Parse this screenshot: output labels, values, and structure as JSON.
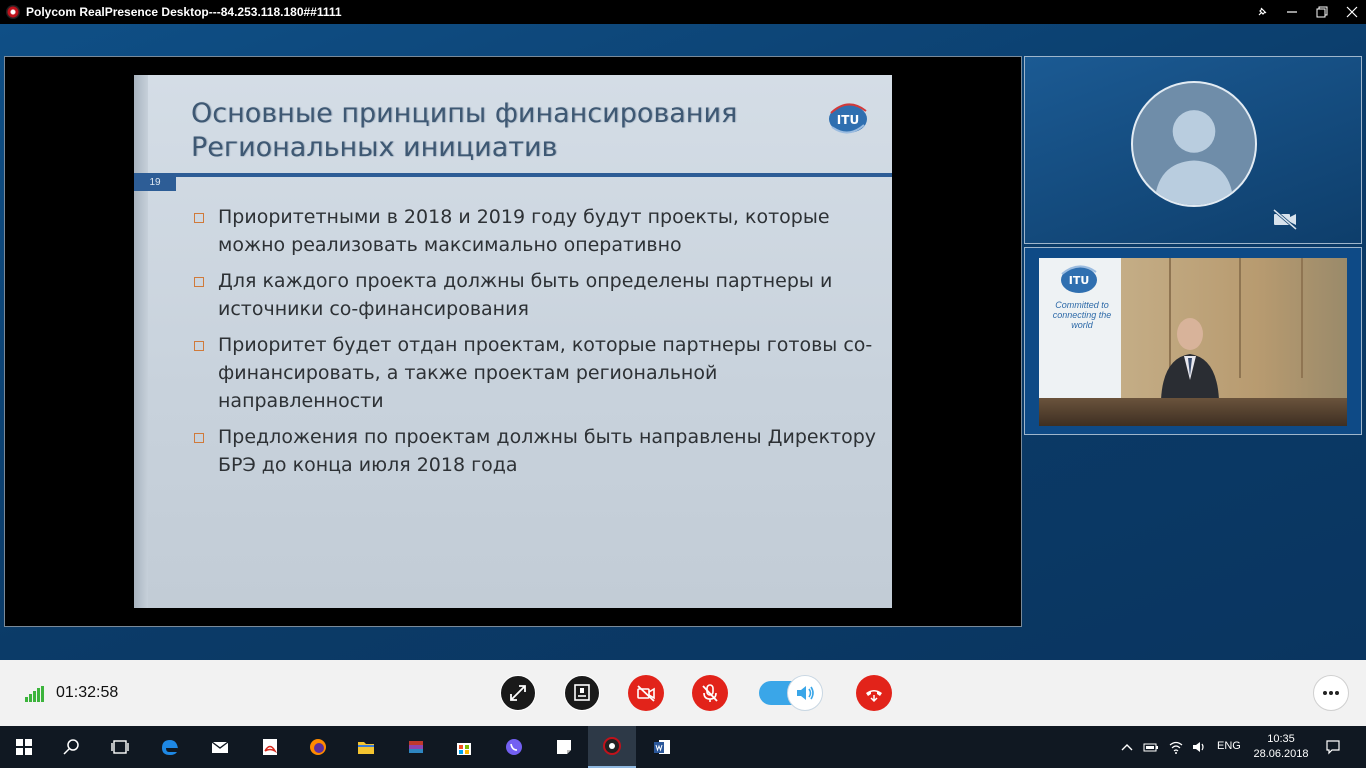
{
  "window": {
    "title": "Polycom RealPresence Desktop---84.253.118.180##1111"
  },
  "slide": {
    "title_line1": "Основные принципы финансирования",
    "title_line2": "Региональных инициатив",
    "page_number": "19",
    "logo_text": "ITU",
    "bullets": [
      "Приоритетными в 2018 и 2019 году будут проекты, которые можно реализовать максимально оперативно",
      "Для каждого проекта должны быть определены партнеры и источники со-финансирования",
      "Приоритет будет отдан проектам, которые партнеры готовы со-финансировать, а также проектам региональной направленности",
      "Предложения по проектам должны быть направлены Директору БРЭ до конца июля 2018 года"
    ]
  },
  "remote_video": {
    "banner_logo": "ITU",
    "banner_text": "Committed to connecting the world"
  },
  "toolbar": {
    "call_duration": "01:32:58",
    "speaker_on": true
  },
  "taskbar": {
    "language": "ENG",
    "time": "10:35",
    "date": "28.06.2018"
  },
  "colors": {
    "accent_blue": "#3aa6e8",
    "hangup_red": "#e2231a",
    "signal_green": "#3cb43c",
    "slide_rule": "#2d5d96"
  }
}
